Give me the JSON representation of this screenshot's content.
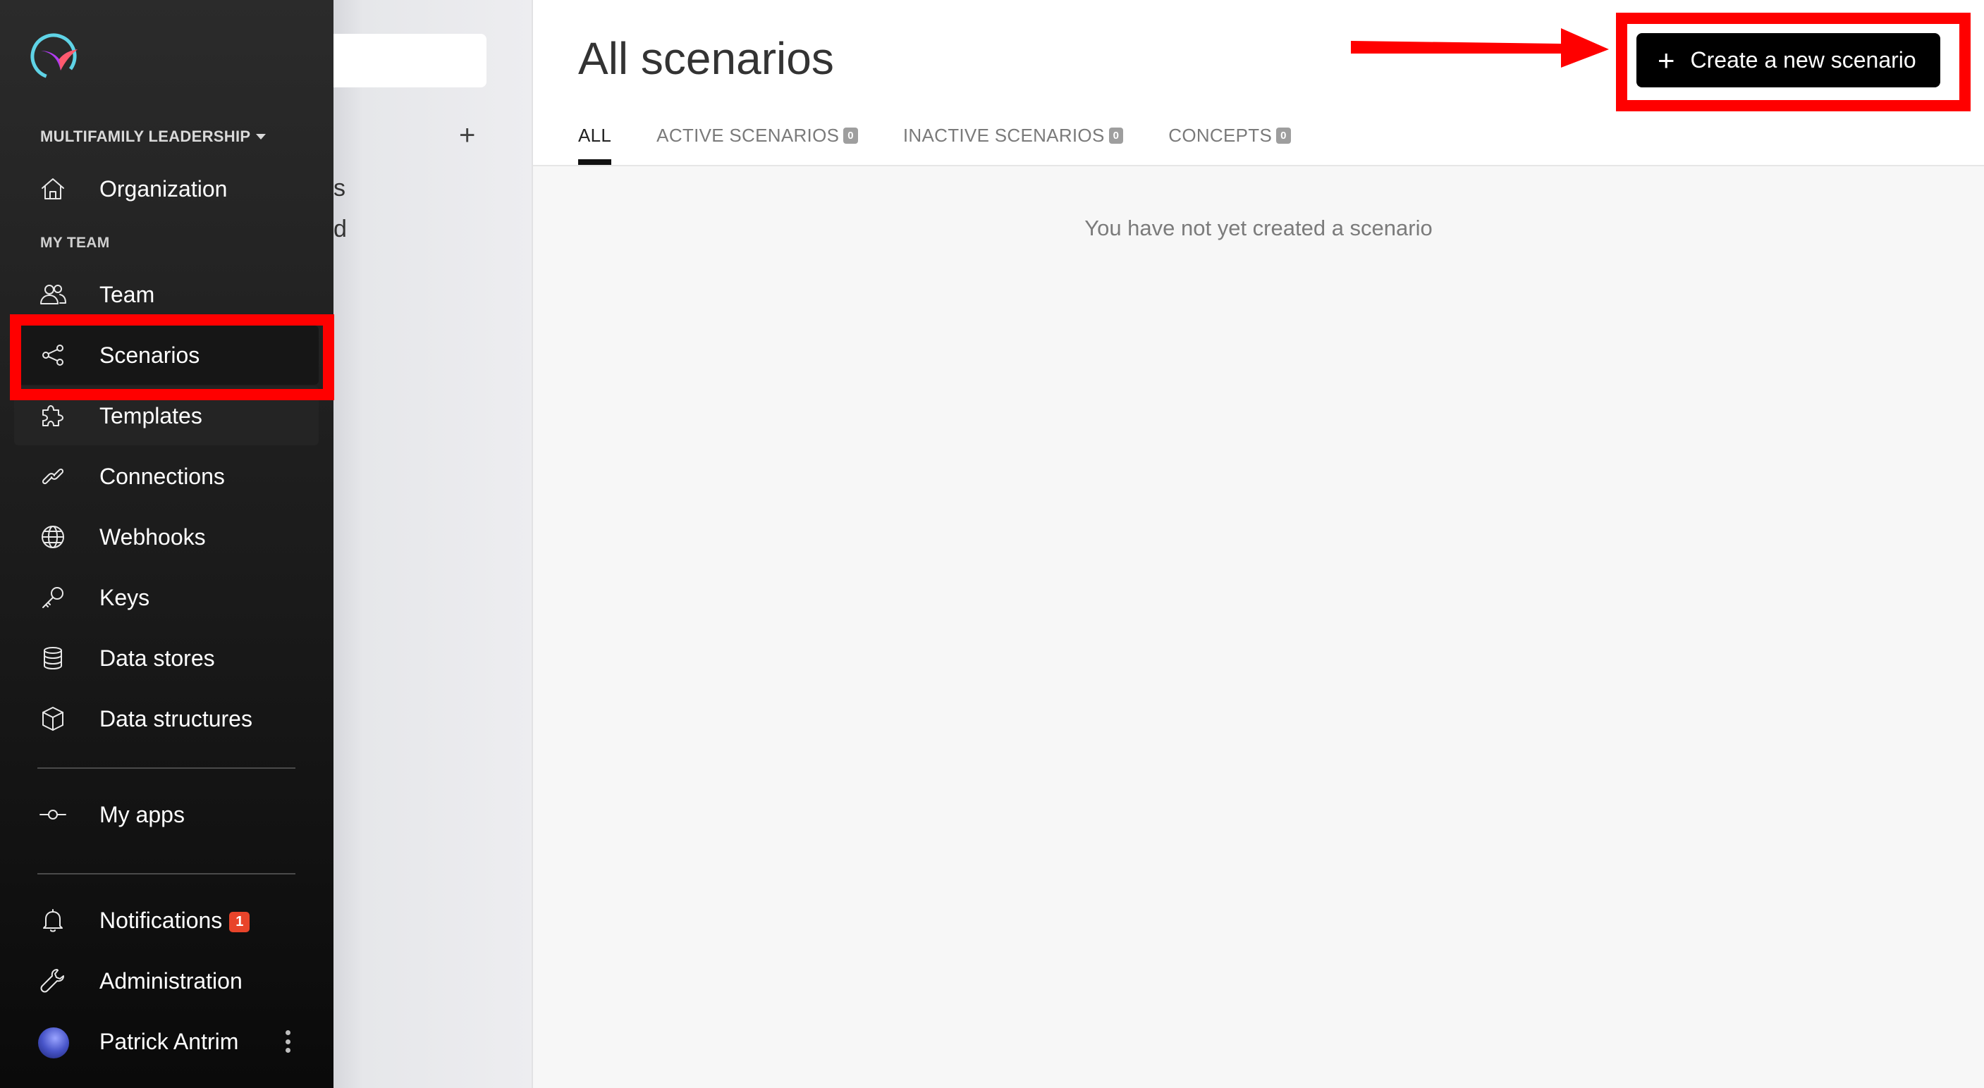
{
  "sidebar": {
    "org_name": "MULTIFAMILY LEADERSHIP",
    "section_label": "MY TEAM",
    "items": [
      {
        "label": "Organization",
        "icon": "home-icon"
      },
      {
        "label": "Team",
        "icon": "users-icon"
      },
      {
        "label": "Scenarios",
        "icon": "share-icon"
      },
      {
        "label": "Templates",
        "icon": "puzzle-icon"
      },
      {
        "label": "Connections",
        "icon": "link-icon"
      },
      {
        "label": "Webhooks",
        "icon": "globe-icon"
      },
      {
        "label": "Keys",
        "icon": "key-icon"
      },
      {
        "label": "Data stores",
        "icon": "database-icon"
      },
      {
        "label": "Data structures",
        "icon": "cube-icon"
      },
      {
        "label": "My apps",
        "icon": "commit-icon"
      },
      {
        "label": "Notifications",
        "icon": "bell-icon",
        "badge": "1"
      },
      {
        "label": "Administration",
        "icon": "wrench-icon"
      },
      {
        "label": "Patrick Antrim",
        "icon": "avatar"
      }
    ]
  },
  "secondary": {
    "plus": "+",
    "fragment_1": "s",
    "fragment_2": "d"
  },
  "main": {
    "title": "All scenarios",
    "create_button": "Create a new scenario",
    "tabs": [
      {
        "label": "ALL",
        "count": ""
      },
      {
        "label": "ACTIVE SCENARIOS",
        "count": "0"
      },
      {
        "label": "INACTIVE SCENARIOS",
        "count": "0"
      },
      {
        "label": "CONCEPTS",
        "count": "0"
      }
    ],
    "empty_message": "You have not yet created a scenario"
  },
  "colors": {
    "annotation_red": "#ff0000",
    "badge_red": "#e8442a",
    "sidebar_bg": "#1a1a1a"
  }
}
